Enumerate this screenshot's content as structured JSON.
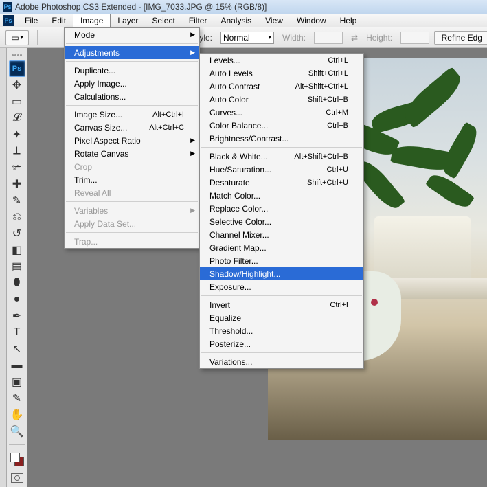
{
  "title": "Adobe Photoshop CS3 Extended - [IMG_7033.JPG @ 15% (RGB/8)]",
  "menubar": [
    "File",
    "Edit",
    "Image",
    "Layer",
    "Select",
    "Filter",
    "Analysis",
    "View",
    "Window",
    "Help"
  ],
  "menubar_open_index": 2,
  "options": {
    "style_label": "Style:",
    "style_value": "Normal",
    "width_label": "Width:",
    "height_label": "Height:",
    "refine_btn": "Refine Edg"
  },
  "image_menu": [
    {
      "type": "item",
      "label": "Mode",
      "sub": true
    },
    {
      "type": "sep"
    },
    {
      "type": "item",
      "label": "Adjustments",
      "sub": true,
      "hi": true
    },
    {
      "type": "sep"
    },
    {
      "type": "item",
      "label": "Duplicate..."
    },
    {
      "type": "item",
      "label": "Apply Image..."
    },
    {
      "type": "item",
      "label": "Calculations..."
    },
    {
      "type": "sep"
    },
    {
      "type": "item",
      "label": "Image Size...",
      "short": "Alt+Ctrl+I"
    },
    {
      "type": "item",
      "label": "Canvas Size...",
      "short": "Alt+Ctrl+C"
    },
    {
      "type": "item",
      "label": "Pixel Aspect Ratio",
      "sub": true
    },
    {
      "type": "item",
      "label": "Rotate Canvas",
      "sub": true
    },
    {
      "type": "item",
      "label": "Crop",
      "dis": true
    },
    {
      "type": "item",
      "label": "Trim..."
    },
    {
      "type": "item",
      "label": "Reveal All",
      "dis": true
    },
    {
      "type": "sep"
    },
    {
      "type": "item",
      "label": "Variables",
      "sub": true,
      "dis": true
    },
    {
      "type": "item",
      "label": "Apply Data Set...",
      "dis": true
    },
    {
      "type": "sep"
    },
    {
      "type": "item",
      "label": "Trap...",
      "dis": true
    }
  ],
  "adjustments_menu": [
    {
      "type": "item",
      "label": "Levels...",
      "short": "Ctrl+L"
    },
    {
      "type": "item",
      "label": "Auto Levels",
      "short": "Shift+Ctrl+L"
    },
    {
      "type": "item",
      "label": "Auto Contrast",
      "short": "Alt+Shift+Ctrl+L"
    },
    {
      "type": "item",
      "label": "Auto Color",
      "short": "Shift+Ctrl+B"
    },
    {
      "type": "item",
      "label": "Curves...",
      "short": "Ctrl+M"
    },
    {
      "type": "item",
      "label": "Color Balance...",
      "short": "Ctrl+B"
    },
    {
      "type": "item",
      "label": "Brightness/Contrast..."
    },
    {
      "type": "sep"
    },
    {
      "type": "item",
      "label": "Black & White...",
      "short": "Alt+Shift+Ctrl+B"
    },
    {
      "type": "item",
      "label": "Hue/Saturation...",
      "short": "Ctrl+U"
    },
    {
      "type": "item",
      "label": "Desaturate",
      "short": "Shift+Ctrl+U"
    },
    {
      "type": "item",
      "label": "Match Color..."
    },
    {
      "type": "item",
      "label": "Replace Color..."
    },
    {
      "type": "item",
      "label": "Selective Color..."
    },
    {
      "type": "item",
      "label": "Channel Mixer..."
    },
    {
      "type": "item",
      "label": "Gradient Map..."
    },
    {
      "type": "item",
      "label": "Photo Filter..."
    },
    {
      "type": "item",
      "label": "Shadow/Highlight...",
      "hi": true
    },
    {
      "type": "item",
      "label": "Exposure..."
    },
    {
      "type": "sep"
    },
    {
      "type": "item",
      "label": "Invert",
      "short": "Ctrl+I"
    },
    {
      "type": "item",
      "label": "Equalize"
    },
    {
      "type": "item",
      "label": "Threshold..."
    },
    {
      "type": "item",
      "label": "Posterize..."
    },
    {
      "type": "sep"
    },
    {
      "type": "item",
      "label": "Variations..."
    }
  ],
  "tools": [
    {
      "name": "ps-icon",
      "glyph": "Ps",
      "sel": true,
      "ps": true
    },
    {
      "name": "move-tool",
      "glyph": "✥"
    },
    {
      "name": "marquee-tool",
      "glyph": "▭"
    },
    {
      "name": "lasso-tool",
      "glyph": "𝓛"
    },
    {
      "name": "wand-tool",
      "glyph": "✦"
    },
    {
      "name": "crop-tool",
      "glyph": "⟂"
    },
    {
      "name": "slice-tool",
      "glyph": "✃"
    },
    {
      "name": "heal-tool",
      "glyph": "✚"
    },
    {
      "name": "brush-tool",
      "glyph": "✎"
    },
    {
      "name": "stamp-tool",
      "glyph": "⎌"
    },
    {
      "name": "history-brush",
      "glyph": "↺"
    },
    {
      "name": "eraser-tool",
      "glyph": "◧"
    },
    {
      "name": "gradient-tool",
      "glyph": "▤"
    },
    {
      "name": "blur-tool",
      "glyph": "⬮"
    },
    {
      "name": "dodge-tool",
      "glyph": "●"
    },
    {
      "name": "pen-tool",
      "glyph": "✒"
    },
    {
      "name": "type-tool",
      "glyph": "T"
    },
    {
      "name": "path-tool",
      "glyph": "↖"
    },
    {
      "name": "shape-tool",
      "glyph": "▬"
    },
    {
      "name": "notes-tool",
      "glyph": "▣"
    },
    {
      "name": "eyedropper-tool",
      "glyph": "✎"
    },
    {
      "name": "hand-tool",
      "glyph": "✋"
    },
    {
      "name": "zoom-tool",
      "glyph": "🔍"
    }
  ]
}
